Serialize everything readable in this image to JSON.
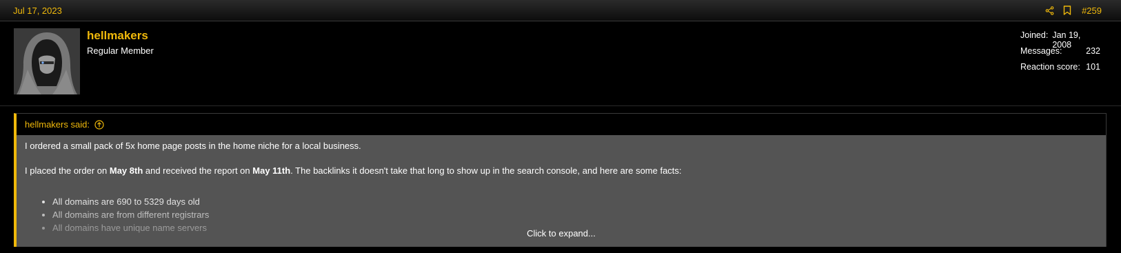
{
  "post": {
    "date": "Jul 17, 2023",
    "number": "#259"
  },
  "icons": {
    "share": "share-icon",
    "bookmark": "bookmark-icon",
    "jump": "arrow-up-circle-icon"
  },
  "colors": {
    "accent": "#f0b90b",
    "quote_bg": "#545454",
    "page_bg": "#000000"
  },
  "user": {
    "name": "hellmakers",
    "title": "Regular Member",
    "stats": {
      "joined_label": "Joined:",
      "joined_value": "Jan 19, 2008",
      "messages_label": "Messages:",
      "messages_value": "232",
      "reaction_label": "Reaction score:",
      "reaction_value": "101"
    }
  },
  "quote": {
    "author_said": "hellmakers said:",
    "paragraph1": "I ordered a small pack of 5x home page posts in the home niche for a local business.",
    "p2_part1": "I placed the order on ",
    "p2_bold1": "May 8th",
    "p2_part2": " and received the report on ",
    "p2_bold2": "May 11th",
    "p2_part3": ". The backlinks it doesn't take that long to show up in the search console, and here are some facts:",
    "facts": [
      "All domains are 690 to 5329 days old",
      "All domains are from different registrars",
      "All domains have unique name servers"
    ],
    "expand_label": "Click to expand..."
  }
}
